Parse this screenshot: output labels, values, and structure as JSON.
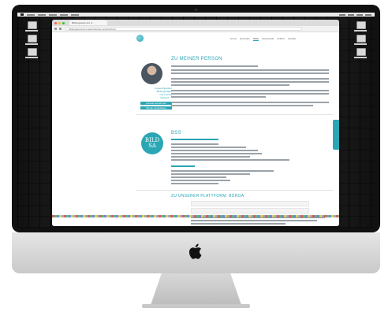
{
  "browser": {
    "tab_title": "Bildungswerk der S…",
    "url": "bildungswerk-der-saechsischen-wirtschaft.de"
  },
  "site": {
    "nav_items": [
      "Home",
      "Seminare",
      "Team",
      "Downloads",
      "Anfahrt",
      "Kontakt"
    ],
    "active_nav": "Team",
    "sidebar_name_lines": [
      "Ansprechpartner",
      "Bildungsträger",
      "und Leitung",
      "Gerhard …"
    ],
    "sidebar_buttons": [
      "Kontakt aufnehmen",
      "Termin vereinbaren"
    ],
    "sections": {
      "about_title": "ZU MEINER PERSON",
      "bss_logo_lines": [
        "BILD",
        "SA"
      ],
      "bss_title": "BSS",
      "bottom_title": "ZU UNSERER PLATTFORM: BÜROA"
    }
  },
  "colors": {
    "accent": "#2aa6b4",
    "bezel": "#111111",
    "aluminum": "#d6d6d6"
  },
  "icons": {
    "apple_logo": "apple-icon",
    "feedback_tab": "feedback-tab"
  }
}
